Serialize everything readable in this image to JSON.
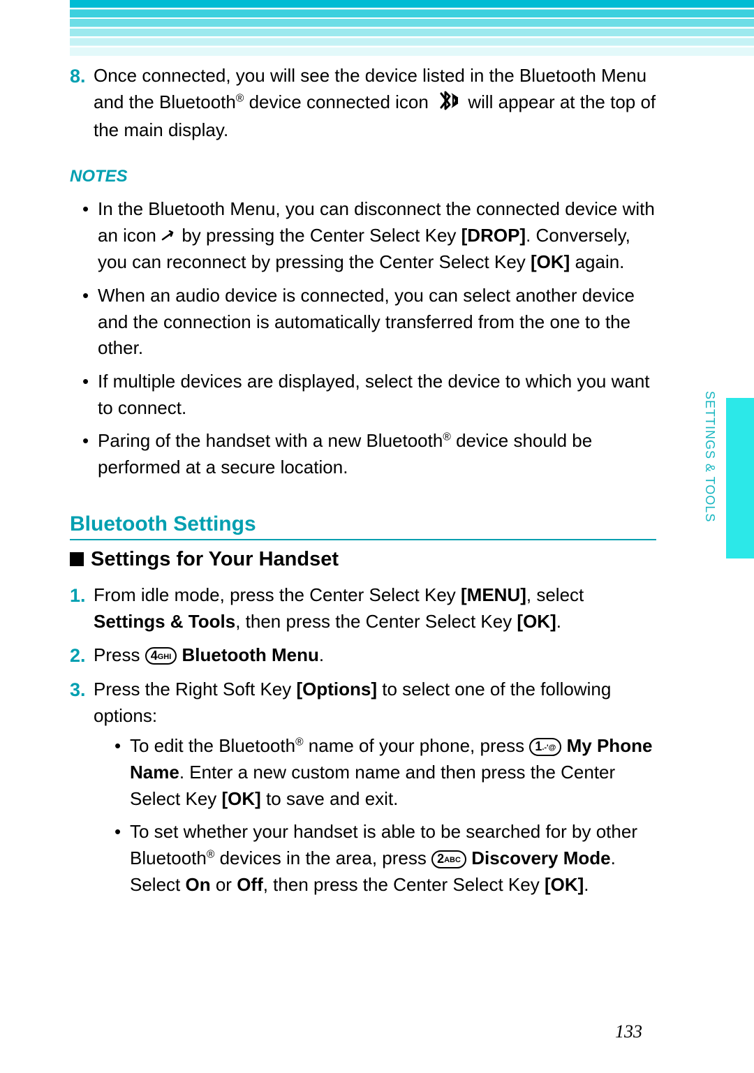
{
  "intro_step_number": "8.",
  "intro_step_text_before": "Once connected, you will see the device listed in the Bluetooth Menu and the Bluetooth",
  "intro_step_reg": "®",
  "intro_step_text_mid": " device connected icon ",
  "intro_step_text_after": " will appear at the top of the main display.",
  "notes_title": "NOTES",
  "notes": {
    "n1a": "In the Bluetooth Menu, you can disconnect the connected device with an icon ",
    "n1b": " by pressing the Center Select Key ",
    "n1_drop": "[DROP]",
    "n1c": ". Conversely, you can reconnect by pressing the Center Select Key ",
    "n1_ok": "[OK]",
    "n1d": " again.",
    "n2": "When an audio device is connected, you can select another device and the connection is automatically transferred from the one to the other.",
    "n3": "If multiple devices are displayed, select the device to which you want to connect.",
    "n4a": "Paring of the handset with a new Bluetooth",
    "n4b": " device should be performed at a secure location."
  },
  "section_heading": "Bluetooth Settings",
  "subsection": "Settings for Your Handset",
  "steps": {
    "s1_num": "1.",
    "s1a": "From idle mode, press the Center Select Key ",
    "s1_menu": "[MENU]",
    "s1b": ", select ",
    "s1_st": "Settings & Tools",
    "s1c": ", then press the Center Select Key ",
    "s1_ok": "[OK]",
    "s1d": ".",
    "s2_num": "2.",
    "s2a": "Press ",
    "s2_key": "4",
    "s2_keysub": "GHI",
    "s2_bm": " Bluetooth Menu",
    "s2b": ".",
    "s3_num": "3.",
    "s3a": "Press the Right Soft Key ",
    "s3_opt": "[Options]",
    "s3b": " to select one of the following options:",
    "s3_sub1a": "To edit the Bluetooth",
    "s3_sub1b": " name of your phone, press ",
    "s3_sub1_key": "1",
    "s3_sub1_keysub": ".-'@",
    "s3_sub1_mpn": " My Phone Name",
    "s3_sub1c": ". Enter a new custom name and then press the Center Select Key ",
    "s3_sub1_ok": "[OK]",
    "s3_sub1d": " to save and exit.",
    "s3_sub2a": "To set whether your handset is able to be searched for by other Bluetooth",
    "s3_sub2b": " devices in the area, press ",
    "s3_sub2_key": "2",
    "s3_sub2_keysub": "ABC",
    "s3_sub2_dm": " Discovery Mode",
    "s3_sub2c": ". Select ",
    "s3_sub2_on": "On",
    "s3_sub2d": " or ",
    "s3_sub2_off": "Off",
    "s3_sub2e": ", then press the Center Select Key ",
    "s3_sub2_ok": "[OK]",
    "s3_sub2f": "."
  },
  "side_label": "SETTINGS & TOOLS",
  "page_number": "133"
}
